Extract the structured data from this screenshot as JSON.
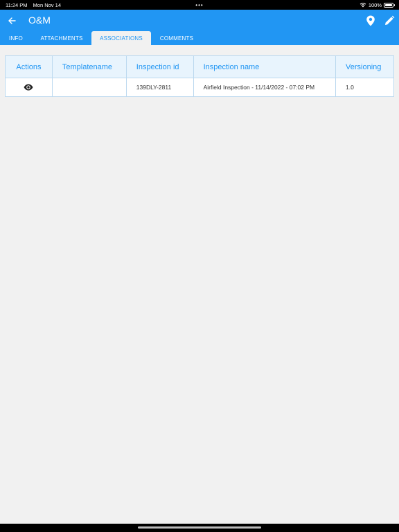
{
  "status": {
    "time": "11:24 PM",
    "date": "Mon Nov 14",
    "dots": "•••",
    "battery": "100%"
  },
  "header": {
    "title": "O&M",
    "back_icon": "back-arrow-icon",
    "location_icon": "map-pin-icon",
    "edit_icon": "pencil-icon"
  },
  "tabs": [
    {
      "label": "INFO",
      "active": false
    },
    {
      "label": "ATTACHMENTS",
      "active": false
    },
    {
      "label": "ASSOCIATIONS",
      "active": true
    },
    {
      "label": "COMMENTS",
      "active": false
    }
  ],
  "table": {
    "columns": [
      "Actions",
      "Templatename",
      "Inspection id",
      "Inspection name",
      "Versioning"
    ],
    "rows": [
      {
        "action_icon": "eye-icon",
        "templatename": "",
        "inspection_id": "139DLY-2811",
        "inspection_name": "Airfield Inspection - 11/14/2022 - 07:02 PM",
        "versioning": "1.0"
      }
    ]
  },
  "colors": {
    "primary": "#2196f3",
    "background": "#f1f1f1",
    "header_row": "#e8f4fd"
  }
}
